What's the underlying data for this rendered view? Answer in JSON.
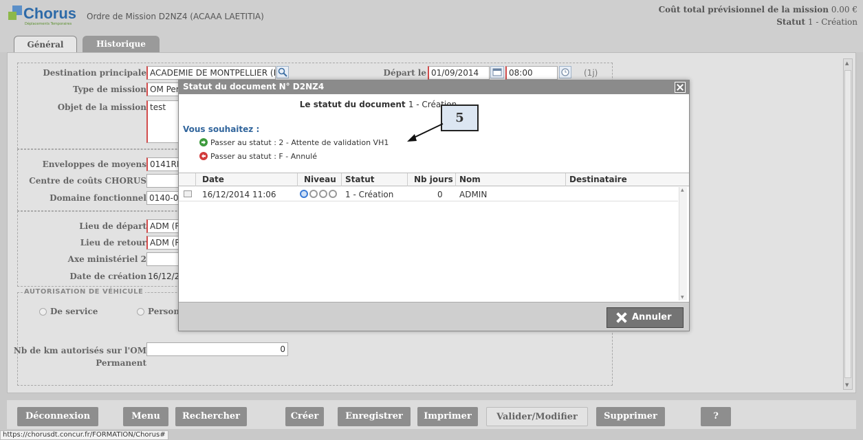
{
  "app": {
    "logo_text": "Chorus",
    "logo_sub": "Déplacements Temporaires",
    "title": "Ordre de Mission D2NZ4 (ACAAA LAETITIA)",
    "cost_label": "Coût total prévisionnel de la mission",
    "cost_value": "0.00 €",
    "status_label": "Statut",
    "status_value": "1 - Création"
  },
  "tabs": [
    "Général",
    "Historique"
  ],
  "form": {
    "destination_label": "Destination principale",
    "destination_value": "ACADEMIE DE MONTPELLIER (FR/",
    "depart_label": "Départ le",
    "depart_date": "01/09/2014",
    "depart_time": "08:00",
    "duration": "(1j)",
    "type_label": "Type de mission",
    "type_value": "OM Pen",
    "objet_label": "Objet de la mission",
    "objet_value": "test",
    "enveloppes_label": "Enveloppes de moyens",
    "enveloppes_value": "0141RE",
    "centre_label": "Centre de coûts CHORUS",
    "centre_value": "",
    "domaine_label": "Domaine fonctionnel",
    "domaine_value": "0140-0",
    "lieu_depart_label": "Lieu de départ",
    "lieu_depart_value": "ADM (R",
    "lieu_retour_label": "Lieu de retour",
    "lieu_retour_value": "ADM (R",
    "axe_label": "Axe ministériel 2",
    "axe_value": "",
    "date_creation_label": "Date de création",
    "date_creation_value": "16/12/2",
    "vehicule_title": "Autorisation de véhicule",
    "radio_service": "De service",
    "radio_perso": "Person",
    "km_label_1": "Nb de km autorisés sur l'OM",
    "km_label_2": "Permanent",
    "km_value": "0"
  },
  "dialog": {
    "title": "Statut du document N° D2NZ4",
    "status_label": "Le statut du document",
    "status_value": "1 - Création",
    "wish_label": "Vous souhaitez :",
    "actions": [
      "Passer au statut : 2 - Attente de validation VH1",
      "Passer au statut : F - Annulé"
    ],
    "columns": [
      "Date",
      "Niveau",
      "Statut",
      "Nb jours",
      "Nom",
      "Destinataire"
    ],
    "rows": [
      {
        "date": "16/12/2014 11:06",
        "level": 1,
        "statut": "1 - Création",
        "nb_jours": "0",
        "nom": "ADMIN",
        "destinataire": ""
      }
    ],
    "cancel_label": "Annuler"
  },
  "callout": {
    "label": "5"
  },
  "toolbar": [
    "Déconnexion",
    "Menu",
    "Rechercher",
    "Créer",
    "Enregistrer",
    "Imprimer",
    "Valider/Modifier",
    "Supprimer",
    "?"
  ],
  "statusbar": "https://chorusdt.concur.fr/FORMATION/Chorus#"
}
